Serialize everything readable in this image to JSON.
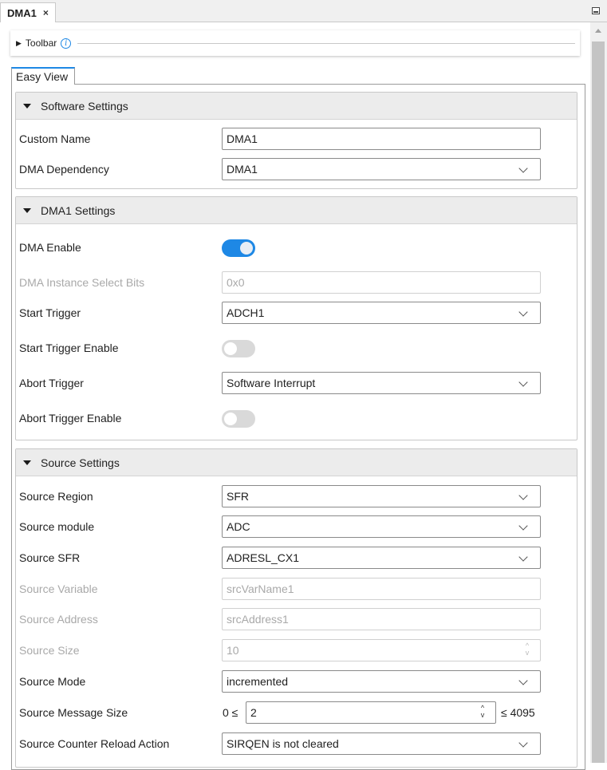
{
  "tab": {
    "title": "DMA1",
    "close": "×"
  },
  "toolbar": {
    "label": "Toolbar",
    "info": "i"
  },
  "view_tab": "Easy View",
  "sections": {
    "software": {
      "title": "Software Settings"
    },
    "dma1": {
      "title": "DMA1 Settings"
    },
    "source": {
      "title": "Source Settings"
    }
  },
  "fields": {
    "custom_name": {
      "label": "Custom Name",
      "value": "DMA1"
    },
    "dma_dependency": {
      "label": "DMA Dependency",
      "value": "DMA1"
    },
    "dma_enable": {
      "label": "DMA Enable",
      "state": "on"
    },
    "instance_select": {
      "label": "DMA Instance Select Bits",
      "value": "0x0"
    },
    "start_trigger": {
      "label": "Start Trigger",
      "value": "ADCH1"
    },
    "start_trigger_enable": {
      "label": "Start Trigger Enable",
      "state": "off"
    },
    "abort_trigger": {
      "label": "Abort Trigger",
      "value": "Software Interrupt"
    },
    "abort_trigger_enable": {
      "label": "Abort Trigger Enable",
      "state": "off"
    },
    "source_region": {
      "label": "Source Region",
      "value": "SFR"
    },
    "source_module": {
      "label": "Source module",
      "value": "ADC"
    },
    "source_sfr": {
      "label": "Source SFR",
      "value": "ADRESL_CX1"
    },
    "source_variable": {
      "label": "Source Variable",
      "placeholder": "srcVarName1"
    },
    "source_address": {
      "label": "Source Address",
      "placeholder": "srcAddress1"
    },
    "source_size": {
      "label": "Source Size",
      "value": "10"
    },
    "source_mode": {
      "label": "Source Mode",
      "value": "incremented"
    },
    "source_message_size": {
      "label": "Source Message Size",
      "min": "0 ≤",
      "value": "2",
      "max": "≤ 4095"
    },
    "source_counter_reload": {
      "label": "Source Counter Reload Action",
      "value": "SIRQEN is not cleared"
    }
  },
  "colors": {
    "accent": "#1e88e5",
    "section_header": "#ececec",
    "disabled_text": "#a9a9a9"
  }
}
